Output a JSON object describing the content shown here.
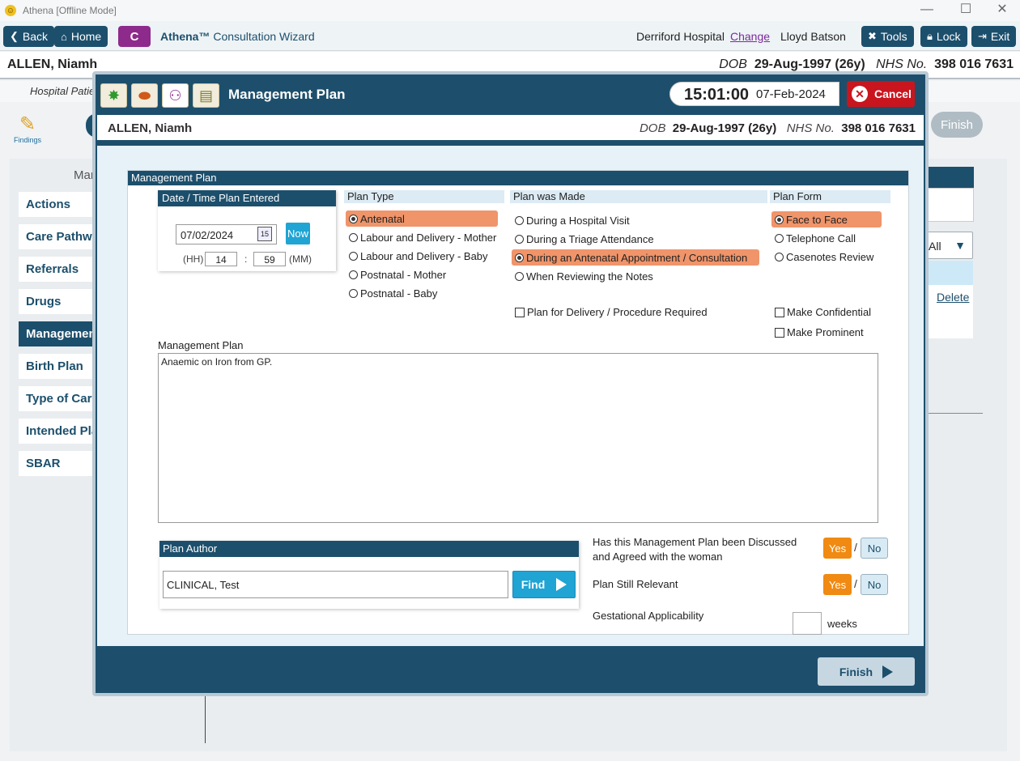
{
  "window": {
    "title": "Athena [Offline Mode]",
    "controls": [
      "—",
      "☐",
      "✕"
    ]
  },
  "topbar": {
    "back": "Back",
    "home": "Home",
    "badge": "C",
    "wizard_brand": "Athena™",
    "wizard_name": " Consultation Wizard",
    "hospital": "Derriford Hospital",
    "change": "Change",
    "user": "Lloyd Batson",
    "tools": "Tools",
    "lock": "Lock",
    "exit": "Exit"
  },
  "patient": {
    "name": "ALLEN, Niamh",
    "dob_label": "DOB",
    "dob": "29-Aug-1997 (26y)",
    "nhs_label": "NHS No.",
    "nhs": "398 016 7631"
  },
  "background": {
    "subbar": "Hospital Patie",
    "findings": "Findings",
    "heading": "Man",
    "finish": "Finish",
    "filter": "All",
    "delete": "Delete",
    "sidebar": [
      "Actions",
      "Care Pathwa",
      "Referrals",
      "Drugs",
      "Managemen",
      "Birth Plan",
      "Type of Care",
      "Intended Pla",
      "SBAR"
    ]
  },
  "modal": {
    "title": "Management Plan",
    "time": "15:01:00",
    "date": "07-Feb-2024",
    "cancel": "Cancel",
    "finish": "Finish",
    "section_title": "Management Plan",
    "date_box": {
      "title": "Date / Time Plan Entered",
      "date_value": "07/02/2024",
      "cal_day": "15",
      "now": "Now",
      "hh_label": "(HH)",
      "hh": "14",
      "sep": ":",
      "mm": "59",
      "mm_label": "(MM)"
    },
    "plan_type": {
      "label": "Plan Type",
      "options": [
        "Antenatal",
        "Labour and Delivery - Mother",
        "Labour and Delivery - Baby",
        "Postnatal - Mother",
        "Postnatal - Baby"
      ],
      "selected": "Antenatal"
    },
    "plan_made": {
      "label": "Plan was Made",
      "options": [
        "During a Hospital Visit",
        "During a Triage Attendance",
        "During an Antenatal Appointment / Consultation",
        "When Reviewing the Notes"
      ],
      "selected": "During an Antenatal Appointment / Consultation",
      "delivery_check": "Plan for Delivery / Procedure Required"
    },
    "plan_form": {
      "label": "Plan Form",
      "options": [
        "Face to Face",
        "Telephone Call",
        "Casenotes Review"
      ],
      "selected": "Face to Face",
      "confidential": "Make Confidential",
      "prominent": "Make Prominent"
    },
    "management_plan": {
      "label": "Management Plan",
      "text": "Anaemic on Iron from GP."
    },
    "author": {
      "title": "Plan Author",
      "value": "CLINICAL, Test",
      "find": "Find"
    },
    "questions": {
      "discussed_1": "Has this Management Plan been Discussed",
      "discussed_2": "and Agreed with the woman",
      "relevant": "Plan Still Relevant",
      "gestational": "Gestational Applicability",
      "yes": "Yes",
      "no": "No",
      "slash": "/",
      "weeks": "weeks"
    }
  }
}
